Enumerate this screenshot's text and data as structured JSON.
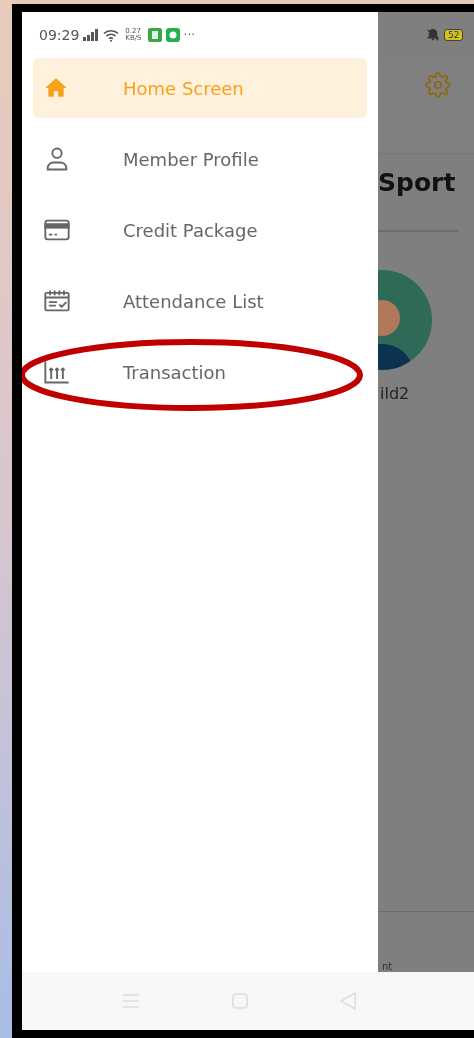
{
  "status_bar": {
    "time": "09:29",
    "speed": "0.27",
    "speed_unit": "KB/S",
    "more": "···",
    "battery": "52"
  },
  "drawer": {
    "items": [
      {
        "label": "Home Screen",
        "kind": "home",
        "selected": true
      },
      {
        "label": "Member Profile",
        "kind": "person",
        "selected": false
      },
      {
        "label": "Credit Package",
        "kind": "card",
        "selected": false
      },
      {
        "label": "Attendance List",
        "kind": "calendar",
        "selected": false
      },
      {
        "label": "Transaction",
        "kind": "chart",
        "selected": false
      }
    ]
  },
  "background_screen": {
    "title": "Sport",
    "avatar_label": "ild2",
    "footer_label": "nt"
  }
}
